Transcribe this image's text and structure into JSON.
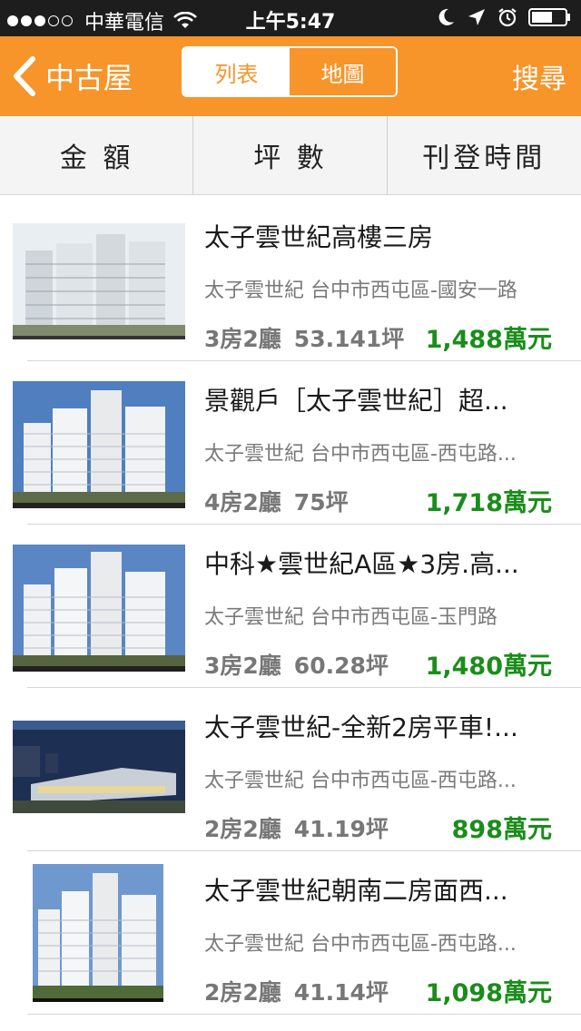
{
  "status_bar": {
    "carrier": "中華電信",
    "time": "上午5:47"
  },
  "nav": {
    "back_label": "中古屋",
    "segments": [
      "列表",
      "地圖"
    ],
    "search_label": "搜尋"
  },
  "sort_bar": {
    "items": [
      "金 額",
      "坪 數",
      "刊登時間"
    ]
  },
  "listings": [
    {
      "title": "太子雲世紀高樓三房",
      "address": "太子雲世紀 台中市西屯區-國安一路",
      "rooms": "3房2廳",
      "size": "53.141坪",
      "price": "1,488萬元"
    },
    {
      "title": "景觀戶［太子雲世紀］超...",
      "address": "太子雲世紀 台中市西屯區-西屯路...",
      "rooms": "4房2廳",
      "size": "75坪",
      "price": "1,718萬元"
    },
    {
      "title": "中科★雲世紀A區★3房.高...",
      "address": "太子雲世紀 台中市西屯區-玉門路",
      "rooms": "3房2廳",
      "size": "60.28坪",
      "price": "1,480萬元"
    },
    {
      "title": "太子雲世紀-全新2房平車!...",
      "address": "太子雲世紀 台中市西屯區-西屯路...",
      "rooms": "2房2廳",
      "size": "41.19坪",
      "price": "898萬元"
    },
    {
      "title": "太子雲世紀朝南二房面西...",
      "address": "太子雲世紀 台中市西屯區-西屯路...",
      "rooms": "2房2廳",
      "size": "41.14坪",
      "price": "1,098萬元"
    }
  ],
  "colors": {
    "accent": "#f7942a",
    "price": "#1a8d1a",
    "status_bar": "#1d1d1d"
  }
}
